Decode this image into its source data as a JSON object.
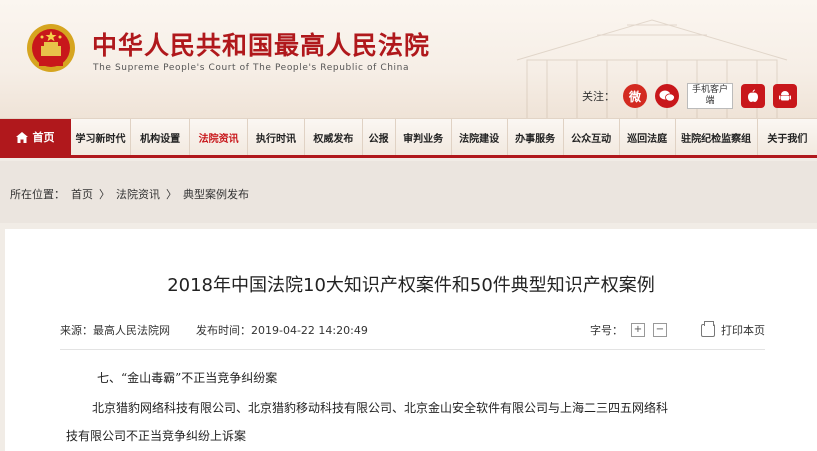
{
  "header": {
    "title": "中华人民共和国最高人民法院",
    "subtitle": "The Supreme People's Court of The People's Republic of China",
    "follow_label": "关注：",
    "mobile_client": "手机客户端"
  },
  "icons": {
    "emblem": "national-emblem-icon",
    "weibo": "weibo-icon",
    "wechat": "wechat-icon",
    "apple": "apple-icon",
    "android": "android-icon",
    "home": "home-icon",
    "print": "printer-icon"
  },
  "nav": {
    "home": "首页",
    "items": [
      "学习新时代",
      "机构设置",
      "法院资讯",
      "执行时讯",
      "权威发布",
      "公报",
      "审判业务",
      "法院建设",
      "办事服务",
      "公众互动",
      "巡回法庭",
      "驻院纪检监察组",
      "关于我们"
    ],
    "active_index": 2
  },
  "breadcrumb": {
    "label": "所在位置：",
    "items": [
      "首页",
      "法院资讯",
      "典型案例发布"
    ],
    "separator": "〉"
  },
  "article": {
    "title": "2018年中国法院10大知识产权案件和50件典型知识产权案例",
    "source_label": "来源：",
    "source": "最高人民法院网",
    "time_label": "发布时间：",
    "time": "2019-04-22 14:20:49",
    "font_label": "字号：",
    "font_plus": "+",
    "font_minus": "−",
    "print_label": "打印本页",
    "section_heading": "七、“金山毒霸”不正当竞争纠纷案",
    "para_line1": "北京猎豹网络科技有限公司、北京猎豹移动科技有限公司、北京金山安全软件有限公司与上海二三四五网络科",
    "para_line2": "技有限公司不正当竞争纠纷上诉案"
  },
  "colors": {
    "brand_red": "#b0181c",
    "active_nav": "#c8171b"
  }
}
